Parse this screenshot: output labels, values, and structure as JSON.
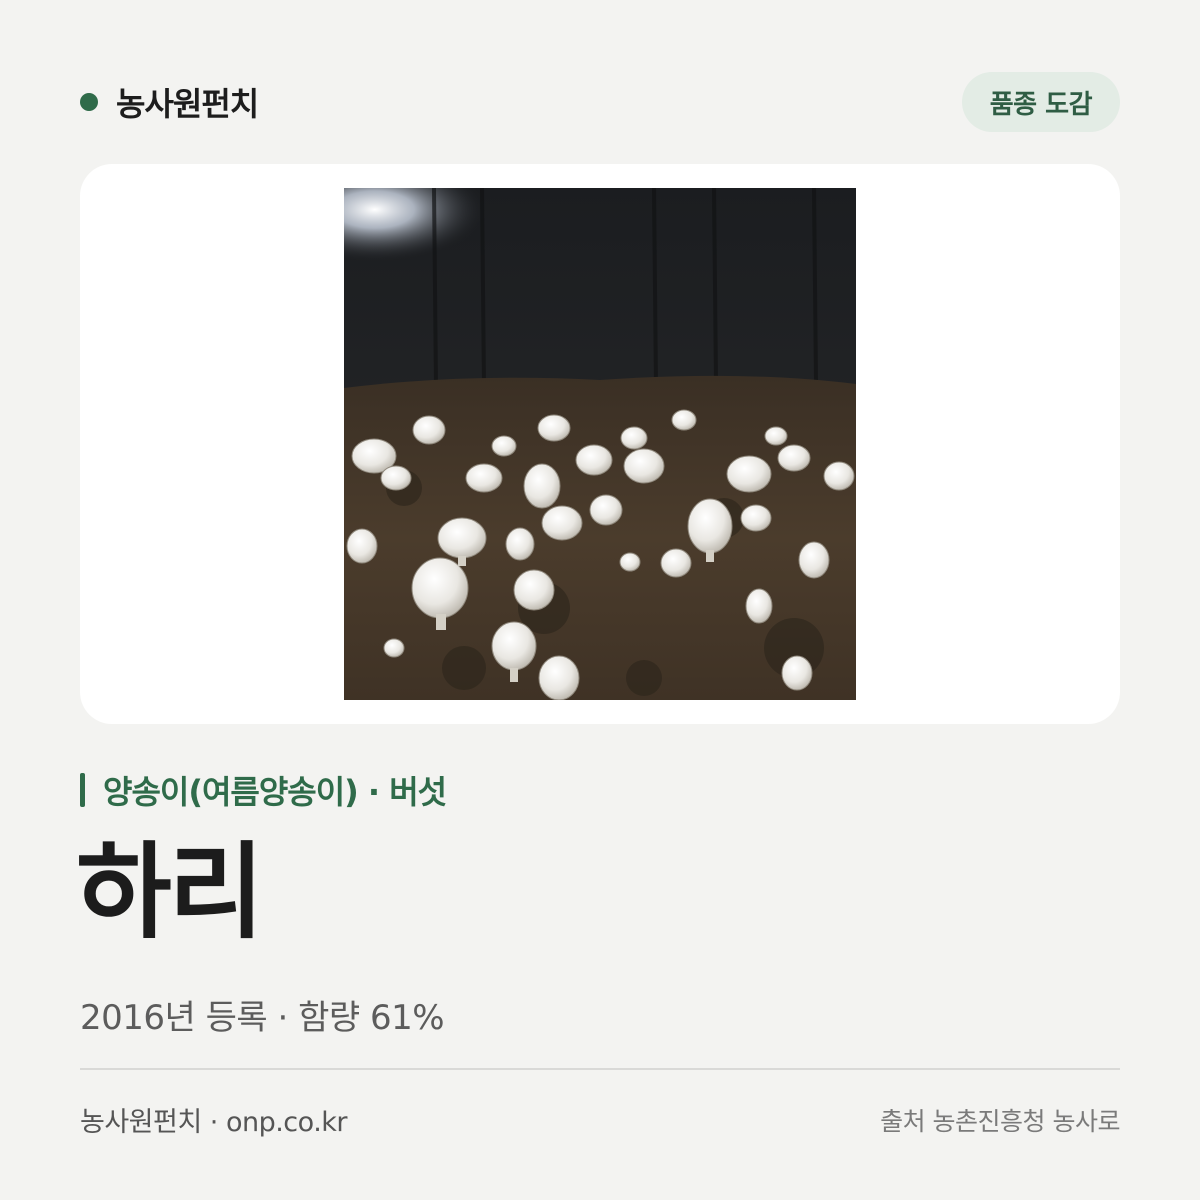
{
  "header": {
    "brand_name": "농사원펀치",
    "badge_label": "품종 도감"
  },
  "photo": {
    "subject": "white button mushrooms growing in dark compost bed"
  },
  "variety": {
    "category": "양송이(여름양송이) · 버섯",
    "name": "하리",
    "meta": "2016년 등록 · 함량 61%"
  },
  "footer": {
    "left": "농사원펀치 · onp.co.kr",
    "right": "출처 농촌진흥청 농사로"
  },
  "colors": {
    "accent": "#2f6b4a",
    "background": "#f3f3f1",
    "badge_bg": "#e3ece5"
  }
}
